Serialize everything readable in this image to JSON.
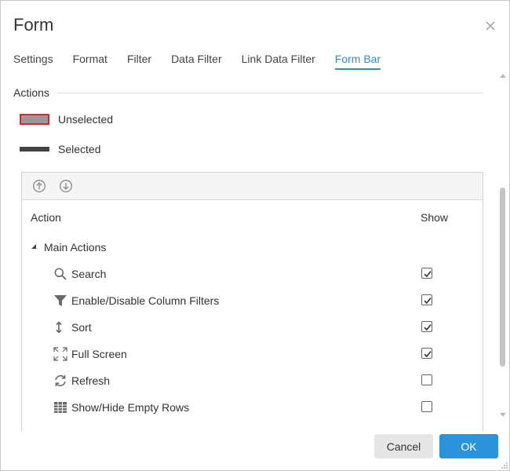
{
  "dialog": {
    "title": "Form",
    "close_icon": "close-icon"
  },
  "tabs": [
    {
      "label": "Settings",
      "active": false
    },
    {
      "label": "Format",
      "active": false
    },
    {
      "label": "Filter",
      "active": false
    },
    {
      "label": "Data Filter",
      "active": false
    },
    {
      "label": "Link Data Filter",
      "active": false
    },
    {
      "label": "Form Bar",
      "active": true
    }
  ],
  "actions_section": {
    "title": "Actions",
    "legend": {
      "unselected_label": "Unselected",
      "selected_label": "Selected",
      "unselected_border_color": "#d9252c",
      "unselected_fill_color": "#9a9a9a",
      "selected_color": "#444444"
    }
  },
  "grid": {
    "toolbar": {
      "move_up_icon": "arrow-up-circle-icon",
      "move_down_icon": "arrow-down-circle-icon"
    },
    "columns": {
      "action": "Action",
      "show": "Show"
    },
    "group": {
      "label": "Main Actions",
      "expanded": true
    },
    "items": [
      {
        "label": "Search",
        "icon": "search-icon",
        "show": true
      },
      {
        "label": "Enable/Disable Column Filters",
        "icon": "filter-icon",
        "show": true
      },
      {
        "label": "Sort",
        "icon": "sort-icon",
        "show": true
      },
      {
        "label": "Full Screen",
        "icon": "fullscreen-icon",
        "show": true
      },
      {
        "label": "Refresh",
        "icon": "refresh-icon",
        "show": false
      },
      {
        "label": "Show/Hide Empty Rows",
        "icon": "grid-icon",
        "show": false
      }
    ]
  },
  "footer": {
    "cancel_label": "Cancel",
    "ok_label": "OK",
    "ok_color": "#2b92dc",
    "active_tab_color": "#2a8fd3"
  }
}
